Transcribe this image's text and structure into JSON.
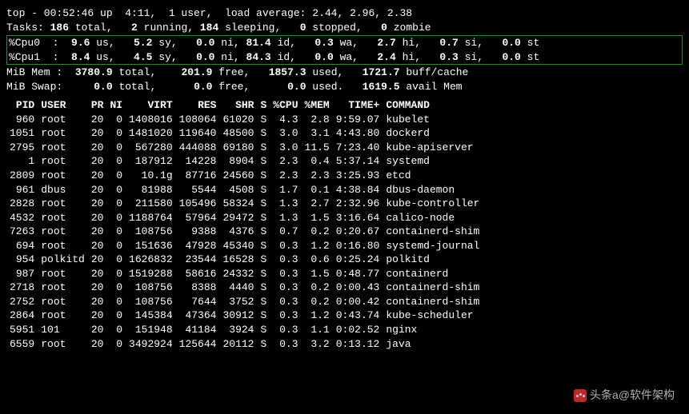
{
  "summary": {
    "line1": "top - 00:52:46 up  4:11,  1 user,  load average: 2.44, 2.96, 2.38",
    "tasks": {
      "total": "186",
      "running": "2",
      "sleeping": "184",
      "stopped": "0",
      "zombie": "0"
    },
    "cpus": [
      {
        "label": "%Cpu0",
        "us": "9.6",
        "sy": "5.2",
        "ni": "0.0",
        "id": "81.4",
        "wa": "0.3",
        "hi": "2.7",
        "si": "0.7",
        "st": "0.0"
      },
      {
        "label": "%Cpu1",
        "us": "8.4",
        "sy": "4.5",
        "ni": "0.0",
        "id": "84.3",
        "wa": "0.0",
        "hi": "2.4",
        "si": "0.3",
        "st": "0.0"
      }
    ],
    "mem": {
      "label": "MiB Mem :",
      "total": "3780.9",
      "free": "201.9",
      "used": "1857.3",
      "buff": "1721.7"
    },
    "swap": {
      "label": "MiB Swap:",
      "total": "0.0",
      "free": "0.0",
      "used": "0.0",
      "avail": "1619.5"
    }
  },
  "columns": [
    "PID",
    "USER",
    "PR",
    "NI",
    "VIRT",
    "RES",
    "SHR",
    "S",
    "%CPU",
    "%MEM",
    "TIME+",
    "COMMAND"
  ],
  "rows": [
    {
      "pid": "960",
      "user": "root",
      "pr": "20",
      "ni": "0",
      "virt": "1408016",
      "res": "108064",
      "shr": "61020",
      "s": "S",
      "cpu": "4.3",
      "mem": "2.8",
      "time": "9:59.07",
      "cmd": "kubelet"
    },
    {
      "pid": "1051",
      "user": "root",
      "pr": "20",
      "ni": "0",
      "virt": "1481020",
      "res": "119640",
      "shr": "48500",
      "s": "S",
      "cpu": "3.0",
      "mem": "3.1",
      "time": "4:43.80",
      "cmd": "dockerd"
    },
    {
      "pid": "2795",
      "user": "root",
      "pr": "20",
      "ni": "0",
      "virt": "567280",
      "res": "444088",
      "shr": "69180",
      "s": "S",
      "cpu": "3.0",
      "mem": "11.5",
      "time": "7:23.40",
      "cmd": "kube-apiserver"
    },
    {
      "pid": "1",
      "user": "root",
      "pr": "20",
      "ni": "0",
      "virt": "187912",
      "res": "14228",
      "shr": "8904",
      "s": "S",
      "cpu": "2.3",
      "mem": "0.4",
      "time": "5:37.14",
      "cmd": "systemd"
    },
    {
      "pid": "2809",
      "user": "root",
      "pr": "20",
      "ni": "0",
      "virt": "10.1g",
      "res": "87716",
      "shr": "24560",
      "s": "S",
      "cpu": "2.3",
      "mem": "2.3",
      "time": "3:25.93",
      "cmd": "etcd"
    },
    {
      "pid": "961",
      "user": "dbus",
      "pr": "20",
      "ni": "0",
      "virt": "81988",
      "res": "5544",
      "shr": "4508",
      "s": "S",
      "cpu": "1.7",
      "mem": "0.1",
      "time": "4:38.84",
      "cmd": "dbus-daemon"
    },
    {
      "pid": "2828",
      "user": "root",
      "pr": "20",
      "ni": "0",
      "virt": "211580",
      "res": "105496",
      "shr": "58324",
      "s": "S",
      "cpu": "1.3",
      "mem": "2.7",
      "time": "2:32.96",
      "cmd": "kube-controller"
    },
    {
      "pid": "4532",
      "user": "root",
      "pr": "20",
      "ni": "0",
      "virt": "1188764",
      "res": "57964",
      "shr": "29472",
      "s": "S",
      "cpu": "1.3",
      "mem": "1.5",
      "time": "3:16.64",
      "cmd": "calico-node"
    },
    {
      "pid": "7263",
      "user": "root",
      "pr": "20",
      "ni": "0",
      "virt": "108756",
      "res": "9388",
      "shr": "4376",
      "s": "S",
      "cpu": "0.7",
      "mem": "0.2",
      "time": "0:20.67",
      "cmd": "containerd-shim"
    },
    {
      "pid": "694",
      "user": "root",
      "pr": "20",
      "ni": "0",
      "virt": "151636",
      "res": "47928",
      "shr": "45340",
      "s": "S",
      "cpu": "0.3",
      "mem": "1.2",
      "time": "0:16.80",
      "cmd": "systemd-journal"
    },
    {
      "pid": "954",
      "user": "polkitd",
      "pr": "20",
      "ni": "0",
      "virt": "1626832",
      "res": "23544",
      "shr": "16528",
      "s": "S",
      "cpu": "0.3",
      "mem": "0.6",
      "time": "0:25.24",
      "cmd": "polkitd"
    },
    {
      "pid": "987",
      "user": "root",
      "pr": "20",
      "ni": "0",
      "virt": "1519288",
      "res": "58616",
      "shr": "24332",
      "s": "S",
      "cpu": "0.3",
      "mem": "1.5",
      "time": "0:48.77",
      "cmd": "containerd"
    },
    {
      "pid": "2718",
      "user": "root",
      "pr": "20",
      "ni": "0",
      "virt": "108756",
      "res": "8388",
      "shr": "4440",
      "s": "S",
      "cpu": "0.3",
      "mem": "0.2",
      "time": "0:00.43",
      "cmd": "containerd-shim"
    },
    {
      "pid": "2752",
      "user": "root",
      "pr": "20",
      "ni": "0",
      "virt": "108756",
      "res": "7644",
      "shr": "3752",
      "s": "S",
      "cpu": "0.3",
      "mem": "0.2",
      "time": "0:00.42",
      "cmd": "containerd-shim"
    },
    {
      "pid": "2864",
      "user": "root",
      "pr": "20",
      "ni": "0",
      "virt": "145384",
      "res": "47364",
      "shr": "30912",
      "s": "S",
      "cpu": "0.3",
      "mem": "1.2",
      "time": "0:43.74",
      "cmd": "kube-scheduler"
    },
    {
      "pid": "5951",
      "user": "101",
      "pr": "20",
      "ni": "0",
      "virt": "151948",
      "res": "41184",
      "shr": "3924",
      "s": "S",
      "cpu": "0.3",
      "mem": "1.1",
      "time": "0:02.52",
      "cmd": "nginx"
    },
    {
      "pid": "6559",
      "user": "root",
      "pr": "20",
      "ni": "0",
      "virt": "3492924",
      "res": "125644",
      "shr": "20112",
      "s": "S",
      "cpu": "0.3",
      "mem": "3.2",
      "time": "0:13.12",
      "cmd": "java"
    }
  ],
  "watermark": "头条a@软件架构"
}
